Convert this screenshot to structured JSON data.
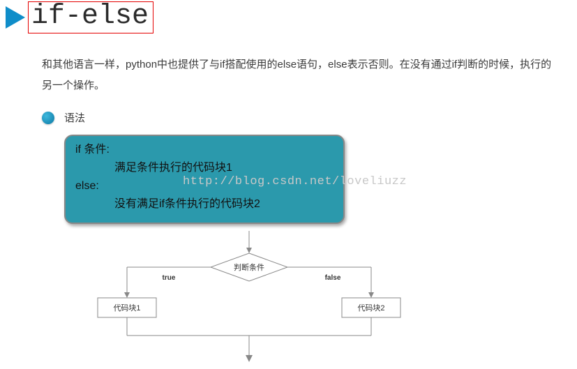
{
  "title": "if-else",
  "description": "和其他语言一样，python中也提供了与if搭配使用的else语句，else表示否则。在没有通过if判断的时候，执行的另一个操作。",
  "bullet_label": "语法",
  "syntax": {
    "line1": "if 条件:",
    "line2": "满足条件执行的代码块1",
    "line3": "else:",
    "line4": "没有满足if条件执行的代码块2"
  },
  "watermark": "http://blog.csdn.net/loveliuzz",
  "flow": {
    "decision": "判断条件",
    "true_label": "true",
    "false_label": "false",
    "block1": "代码块1",
    "block2": "代码块2"
  }
}
